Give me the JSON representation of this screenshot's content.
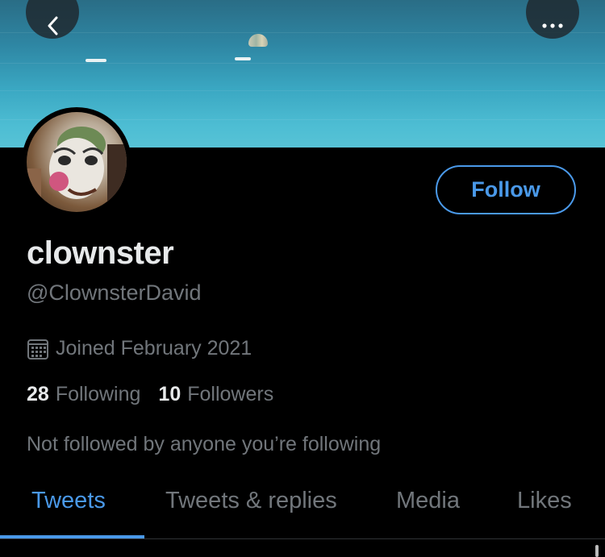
{
  "profile": {
    "display_name": "clownster",
    "handle": "@ClownsterDavid",
    "joined": "Joined February 2021",
    "following_count": "28",
    "following_label": "Following",
    "followers_count": "10",
    "followers_label": "Followers",
    "mutual_text": "Not followed by anyone you’re following"
  },
  "actions": {
    "follow_label": "Follow",
    "back_icon": "chevron-left-icon",
    "more_icon": "more-horizontal-icon"
  },
  "tabs": [
    {
      "label": "Tweets",
      "active": true
    },
    {
      "label": "Tweets & replies",
      "active": false
    },
    {
      "label": "Media",
      "active": false
    },
    {
      "label": "Likes",
      "active": false
    }
  ],
  "colors": {
    "accent": "#4a99e9",
    "background": "#000000",
    "primary_text": "#e7e9ea",
    "secondary_text": "#71767b"
  }
}
